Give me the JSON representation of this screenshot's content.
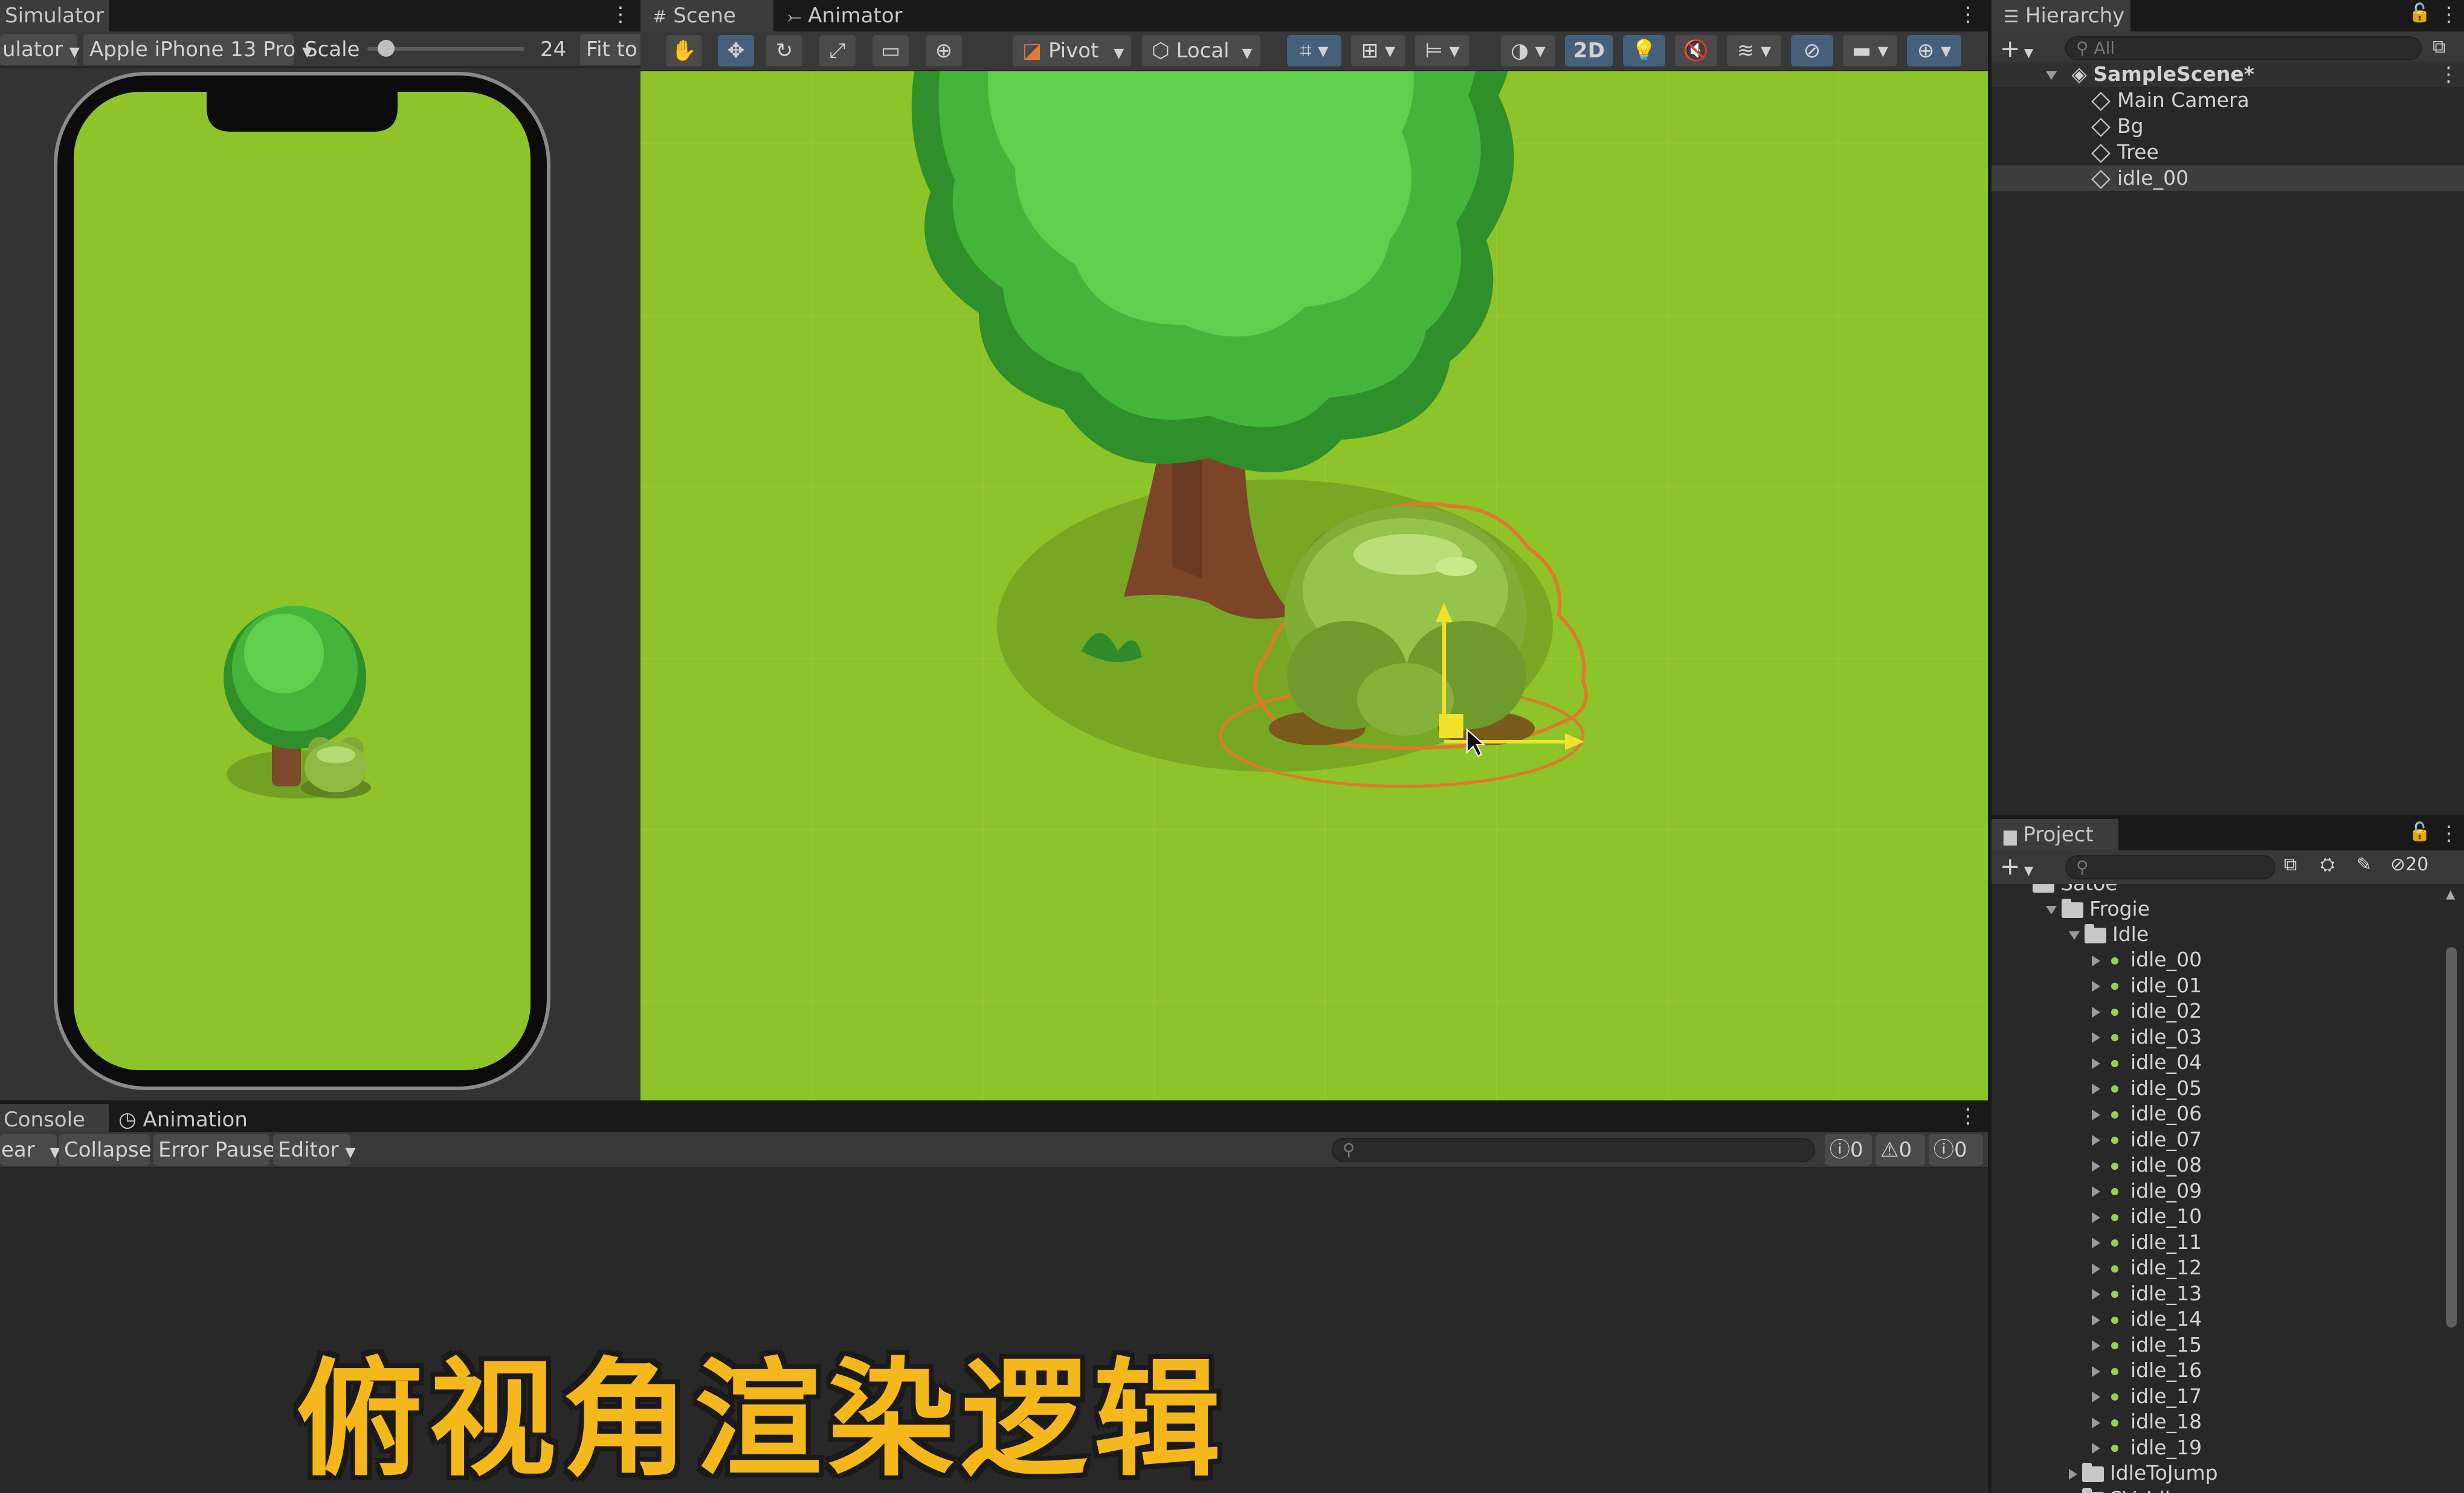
{
  "simulator": {
    "tab_label": "Simulator",
    "mode_label": "ulator",
    "device_label": "Apple iPhone 13 Pro",
    "scale_label": "Scale",
    "scale_value": "24",
    "scale_fraction": 0.12,
    "fit_label": "Fit to"
  },
  "scene": {
    "tabs": [
      {
        "label": "Scene"
      },
      {
        "label": "Animator"
      }
    ],
    "pivot_label": "Pivot",
    "local_label": "Local",
    "mode_2d_label": "2D"
  },
  "hierarchy": {
    "tab_label": "Hierarchy",
    "search_placeholder": "All",
    "scene_name": "SampleScene*",
    "items": [
      {
        "label": "Main Camera"
      },
      {
        "label": "Bg"
      },
      {
        "label": "Tree"
      },
      {
        "label": "idle_00"
      }
    ]
  },
  "project": {
    "tab_label": "Project",
    "hidden_count": "20",
    "partial_item": "Satoe",
    "folder_frogie": "Frogie",
    "folder_idle": "Idle",
    "items": [
      {
        "label": "idle_00"
      },
      {
        "label": "idle_01"
      },
      {
        "label": "idle_02"
      },
      {
        "label": "idle_03"
      },
      {
        "label": "idle_04"
      },
      {
        "label": "idle_05"
      },
      {
        "label": "idle_06"
      },
      {
        "label": "idle_07"
      },
      {
        "label": "idle_08"
      },
      {
        "label": "idle_09"
      },
      {
        "label": "idle_10"
      },
      {
        "label": "idle_11"
      },
      {
        "label": "idle_12"
      },
      {
        "label": "idle_13"
      },
      {
        "label": "idle_14"
      },
      {
        "label": "idle_15"
      },
      {
        "label": "idle_16"
      },
      {
        "label": "idle_17"
      },
      {
        "label": "idle_18"
      },
      {
        "label": "idle_19"
      }
    ],
    "folder_idle_to_jump": "IdleToJump",
    "partial_bottom": "SV_Idle"
  },
  "console": {
    "tabs": [
      {
        "label": "Console"
      },
      {
        "label": "Animation"
      }
    ],
    "clear_label": "ear",
    "collapse_label": "Collapse",
    "error_pause_label": "Error Pause",
    "editor_label": "Editor",
    "info_count": "0",
    "warn_count": "0",
    "error_count": "0"
  },
  "caption": "俯视角渲染逻辑",
  "colors": {
    "grass": "#8cc42a",
    "accent_selected": "#46607c",
    "caption": "#f5b81c"
  }
}
